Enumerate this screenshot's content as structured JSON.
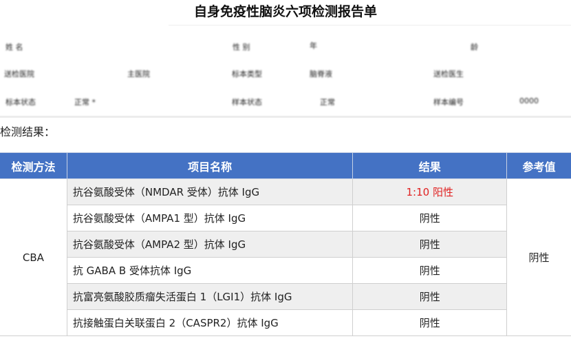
{
  "title": "自身免疫性脑炎六项检测报告单",
  "info": {
    "row1": [
      "姓  名",
      "性  别",
      "年",
      "龄"
    ],
    "row2": [
      "送检医院",
      "主医院",
      "标本类型",
      "脑脊液",
      "送检医生"
    ],
    "row3": [
      "标本状态",
      "正常 *",
      "样本状态",
      "正常",
      "样本编号",
      "0000"
    ]
  },
  "section_label": "检测结果：",
  "table": {
    "headers": [
      "检测方法",
      "项目名称",
      "结果",
      "参考值"
    ],
    "method": "CBA",
    "reference": "阴性",
    "rows": [
      {
        "name": "抗谷氨酸受体（NMDAR 受体）抗体 IgG",
        "result": "1:10  阳性",
        "positive": true
      },
      {
        "name": "抗谷氨酸受体（AMPA1 型）抗体 IgG",
        "result": "阴性",
        "positive": false
      },
      {
        "name": "抗谷氨酸受体（AMPA2 型）抗体 IgG",
        "result": "阴性",
        "positive": false
      },
      {
        "name": "抗 GABA B 受体抗体 IgG",
        "result": "阴性",
        "positive": false
      },
      {
        "name": "抗富亮氨酸胶质瘤失活蛋白 1（LGI1）抗体 IgG",
        "result": "阴性",
        "positive": false
      },
      {
        "name": "抗接触蛋白关联蛋白 2（CASPR2）抗体 IgG",
        "result": "阴性",
        "positive": false
      }
    ]
  },
  "colors": {
    "header_bg": "#4472c4",
    "positive": "#e02020",
    "row_alt": "#efefef"
  }
}
